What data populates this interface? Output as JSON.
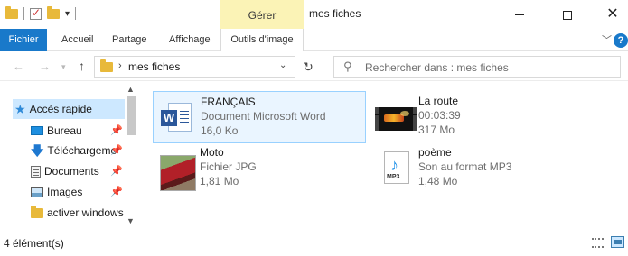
{
  "window": {
    "title": "mes fiches",
    "context_group": "Gérer"
  },
  "ribbon": {
    "tabs": [
      "Fichier",
      "Accueil",
      "Partage",
      "Affichage",
      "Outils d'image"
    ]
  },
  "address": {
    "path": "mes fiches",
    "search_placeholder": "Rechercher dans : mes fiches"
  },
  "nav": {
    "items": [
      {
        "label": "Accès rapide",
        "icon": "star-icon"
      },
      {
        "label": "Bureau",
        "icon": "desktop-icon",
        "pinned": true
      },
      {
        "label": "Téléchargeme",
        "icon": "download-icon",
        "pinned": true
      },
      {
        "label": "Documents",
        "icon": "documents-icon",
        "pinned": true
      },
      {
        "label": "Images",
        "icon": "pictures-icon",
        "pinned": true
      },
      {
        "label": "activer windows",
        "icon": "folder-icon"
      }
    ]
  },
  "files": [
    {
      "name": "FRANÇAIS",
      "line1": "Document Microsoft Word",
      "line2": "16,0 Ko",
      "icon": "word-document-icon"
    },
    {
      "name": "La route",
      "line1": "00:03:39",
      "line2": "317 Mo",
      "icon": "video-thumbnail"
    },
    {
      "name": "Moto",
      "line1": "Fichier JPG",
      "line2": "1,81 Mo",
      "icon": "photo-thumbnail"
    },
    {
      "name": "poème",
      "line1": "Son au format MP3",
      "line2": "1,48 Mo",
      "icon": "mp3-icon",
      "icon_label": "MP3"
    }
  ],
  "status": {
    "count": "4 élément(s)"
  },
  "colors": {
    "accent": "#1979ca",
    "context_tab": "#fbf3b6",
    "selection": "#cde8ff"
  }
}
